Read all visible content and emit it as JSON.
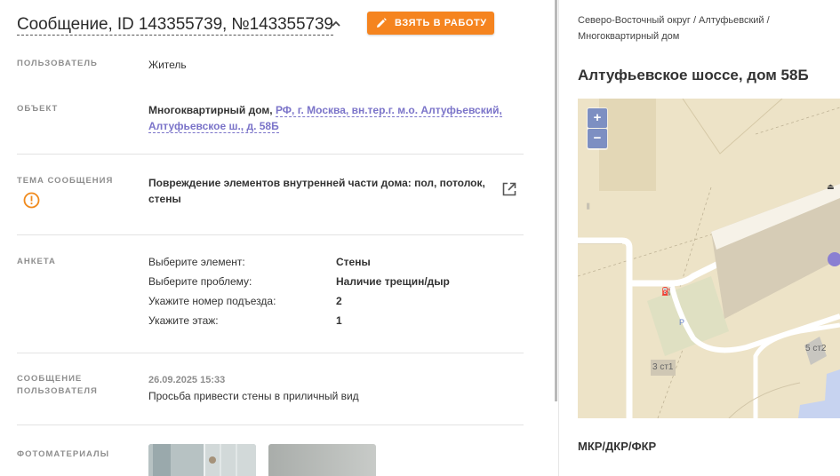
{
  "header": {
    "title": "Сообщение, ID 143355739, №143355739",
    "take_button": "ВЗЯТЬ В РАБОТУ"
  },
  "user": {
    "label": "ПОЛЬЗОВАТЕЛЬ",
    "value": "Житель"
  },
  "object": {
    "label": "ОБЪЕКТ",
    "type": "Многоквартирный дом,",
    "address_line1": "РФ, г. Москва, вн.тер.г. м.о. Алтуфьевский,",
    "address_line2": "Алтуфьевское ш., д. 58Б"
  },
  "topic": {
    "label": "ТЕМА СООБЩЕНИЯ",
    "line1": "Повреждение элементов внутренней части дома: пол, потолок,",
    "line2": "стены"
  },
  "survey": {
    "label": "АНКЕТА",
    "rows": [
      {
        "q": "Выберите элемент:",
        "a": "Стены"
      },
      {
        "q": "Выберите проблему:",
        "a": "Наличие трещин/дыр"
      },
      {
        "q": "Укажите номер подъезда:",
        "a": "2"
      },
      {
        "q": "Укажите этаж:",
        "a": "1"
      }
    ]
  },
  "user_message": {
    "label_line1": "СООБЩЕНИЕ",
    "label_line2": "ПОЛЬЗОВАТЕЛЯ",
    "date": "26.09.2025 15:33",
    "text": "Просьба привести стены в приличный вид"
  },
  "photos": {
    "label": "ФОТОМАТЕРИАЛЫ"
  },
  "location": {
    "breadcrumb_line1": "Северо-Восточный округ / Алтуфьевский /",
    "breadcrumb_line2": "Многоквартирный дом",
    "address": "Алтуфьевское шоссе, дом 58Б"
  },
  "map": {
    "zoom_in": "+",
    "zoom_out": "−",
    "labels": {
      "bldg_a": "3 ст1",
      "bldg_b": "5 ст2",
      "parking": "P"
    }
  },
  "footer_label": "МКР/ДКР/ФКР",
  "colors": {
    "accent": "#f5841f",
    "link": "#7b74c9",
    "warning": "#f08a1c",
    "map_bg": "#ede3c7"
  }
}
